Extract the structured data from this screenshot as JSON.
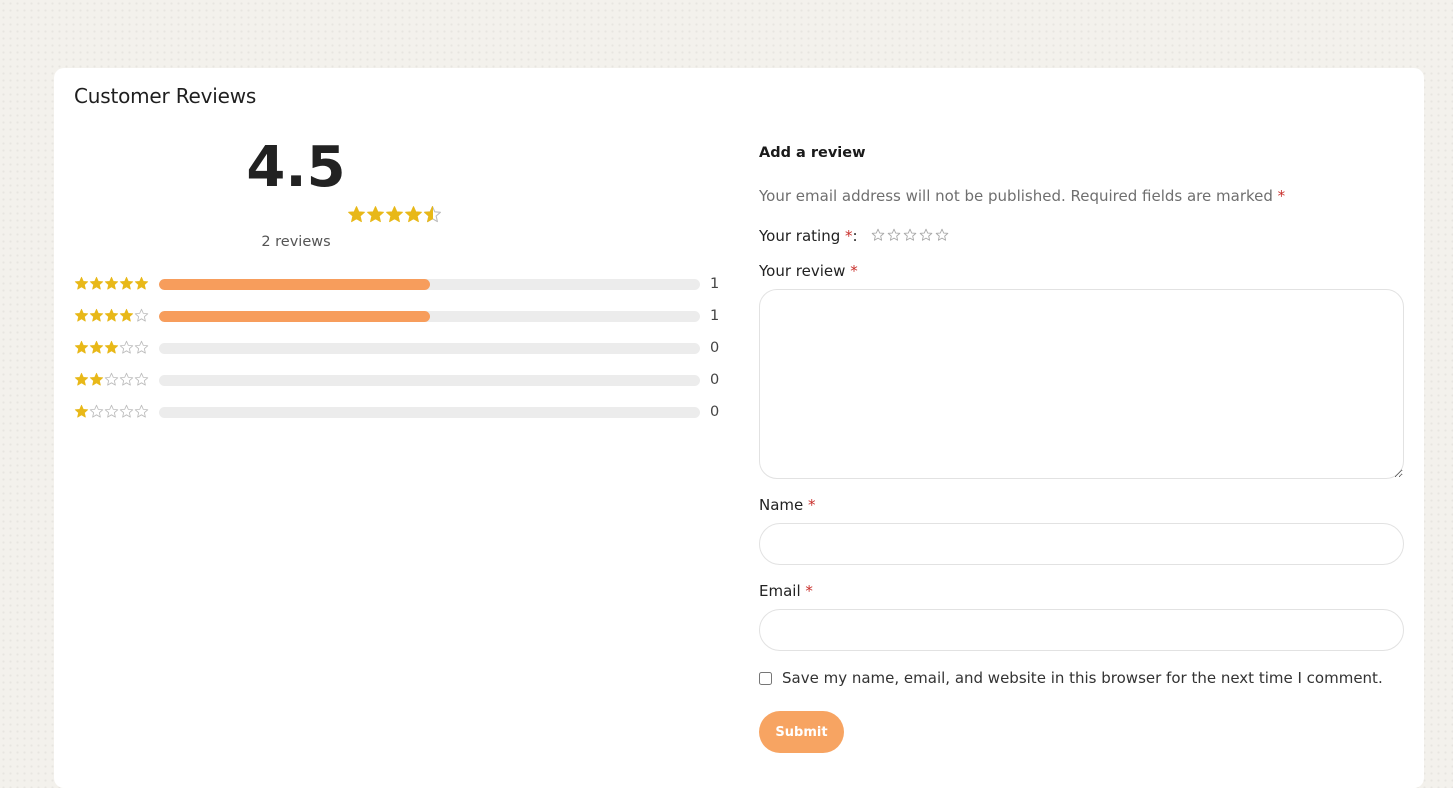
{
  "section": {
    "title": "Customer Reviews"
  },
  "summary": {
    "average": "4.5",
    "average_rating": 4.5,
    "max_rating": 5,
    "count_label": "2 reviews",
    "star_color": "#e8b818",
    "empty_star_color": "#bdbdbd"
  },
  "breakdown": [
    {
      "stars": 5,
      "count": "1",
      "fraction": 0.5
    },
    {
      "stars": 4,
      "count": "1",
      "fraction": 0.5
    },
    {
      "stars": 3,
      "count": "0",
      "fraction": 0
    },
    {
      "stars": 2,
      "count": "0",
      "fraction": 0
    },
    {
      "stars": 1,
      "count": "0",
      "fraction": 0
    }
  ],
  "bar_color": "#f79d5c",
  "form": {
    "title": "Add a review",
    "notes": "Your email address will not be published. Required fields are marked",
    "required_mark": "*",
    "rating_label": "Your rating",
    "rating_suffix": ":",
    "review_label": "Your review",
    "review_value": "",
    "name_label": "Name",
    "name_value": "",
    "email_label": "Email",
    "email_value": "",
    "cookies_label": "Save my name, email, and website in this browser for the next time I comment.",
    "cookies_checked": false,
    "submit_label": "Submit",
    "accent": "#f7a462"
  }
}
